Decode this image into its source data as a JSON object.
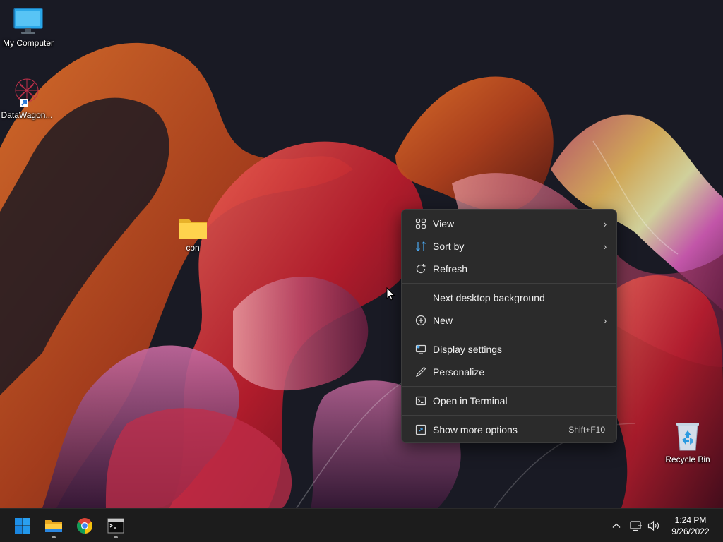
{
  "desktop": {
    "icons": [
      {
        "label": "My Computer",
        "icon": "monitor-icon"
      },
      {
        "label": "DataWagon...",
        "icon": "datawagon-shortcut-icon"
      },
      {
        "label": "con",
        "icon": "folder-icon"
      },
      {
        "label": "Recycle Bin",
        "icon": "recycle-bin-icon"
      }
    ]
  },
  "context_menu": {
    "items": [
      {
        "label": "View",
        "icon": "view-grid-icon",
        "submenu": true
      },
      {
        "label": "Sort by",
        "icon": "sort-arrows-icon",
        "submenu": true
      },
      {
        "label": "Refresh",
        "icon": "refresh-icon"
      },
      {
        "label": "Next desktop background"
      },
      {
        "label": "New",
        "icon": "plus-circle-icon",
        "submenu": true
      },
      {
        "label": "Display settings",
        "icon": "display-settings-icon"
      },
      {
        "label": "Personalize",
        "icon": "pen-icon"
      },
      {
        "label": "Open in Terminal",
        "icon": "terminal-icon"
      },
      {
        "label": "Show more options",
        "icon": "more-options-icon",
        "shortcut": "Shift+F10"
      }
    ],
    "submenu_arrow": "›"
  },
  "taskbar": {
    "apps": [
      {
        "name": "start-button",
        "icon": "windows-logo-icon"
      },
      {
        "name": "file-explorer",
        "icon": "file-explorer-icon",
        "running": true
      },
      {
        "name": "chrome",
        "icon": "chrome-icon"
      },
      {
        "name": "terminal",
        "icon": "terminal-app-icon",
        "running": true
      }
    ],
    "tray": {
      "icons": [
        "chevron-up-icon",
        "network-icon",
        "volume-icon"
      ]
    },
    "clock": {
      "time": "1:24 PM",
      "date": "9/26/2022"
    }
  },
  "colors": {
    "menu_bg": "#2b2b2b",
    "taskbar_bg": "#1c1c1c",
    "accent": "#0078d4"
  }
}
